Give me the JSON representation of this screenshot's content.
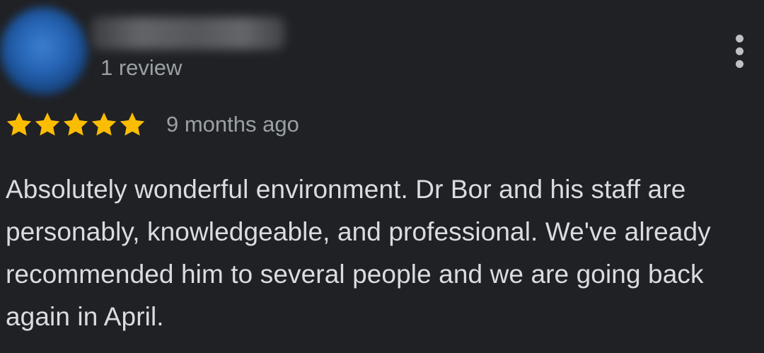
{
  "reviewer": {
    "avatar_color": "#2563b3",
    "review_count": "1 review"
  },
  "menu": {
    "icon": "more-vert-icon"
  },
  "rating": {
    "stars": 5,
    "max_stars": 5,
    "star_color": "#fbbc04",
    "star_icon": "star-icon",
    "time_ago": "9 months ago"
  },
  "review": {
    "text": "Absolutely wonderful environment. Dr Bor and his staff are personably, knowledgeable, and professional. We've already recommended him to several people and we are going back again in April."
  }
}
